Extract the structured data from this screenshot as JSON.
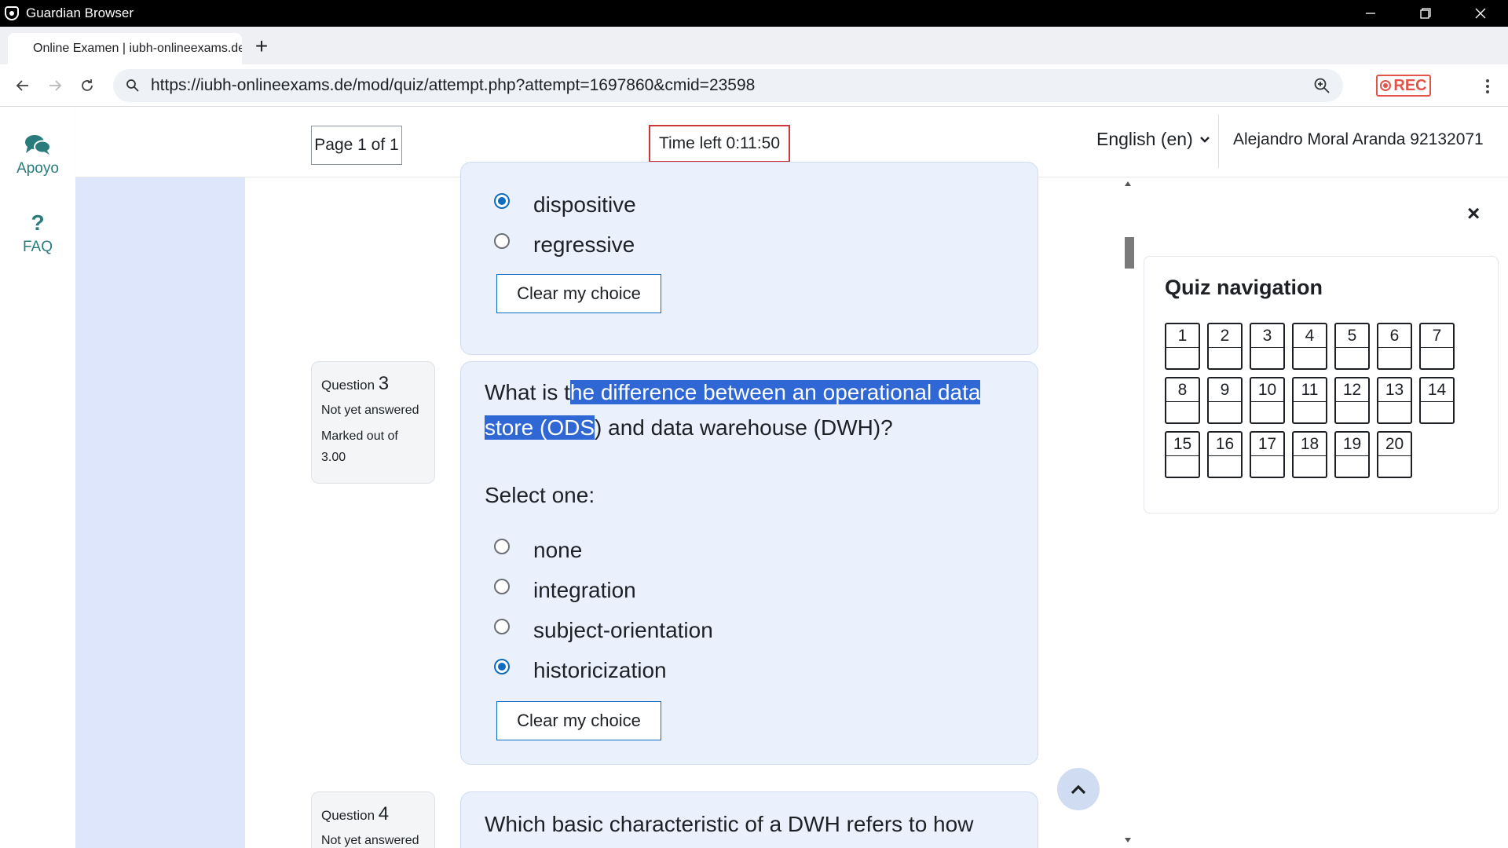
{
  "window": {
    "title": "Guardian Browser"
  },
  "browser": {
    "tab_title": "Online Examen | iubh-onlineexams.de",
    "new_tab": "+",
    "url": "https://iubh-onlineexams.de/mod/quiz/attempt.php?attempt=1697860&cmid=23598",
    "rec_label": "REC"
  },
  "sidebar": {
    "items": [
      {
        "label": "Apoyo",
        "icon": "chat-icon"
      },
      {
        "label": "FAQ",
        "icon": "question-icon"
      }
    ]
  },
  "header": {
    "page": "Page 1 of 1",
    "timer": "Time left 0:11:50",
    "language": "English (en)",
    "user": "Alejandro Moral Aranda 92132071"
  },
  "question2_partial": {
    "options": [
      {
        "label": "dispositive",
        "checked": true
      },
      {
        "label": "regressive",
        "checked": false
      }
    ],
    "clear_label": "Clear my choice"
  },
  "question3": {
    "number_label": "Question",
    "number": "3",
    "status": "Not yet answered",
    "marked": "Marked out of 3.00",
    "text_before": "What is t",
    "text_highlight_1": "he difference between an operational data",
    "text_highlight_2": "store (ODS",
    "text_after": ") and data warehouse (DWH)?",
    "select_label": "Select one:",
    "options": [
      {
        "label": "none",
        "checked": false
      },
      {
        "label": "integration",
        "checked": false
      },
      {
        "label": "subject-orientation",
        "checked": false
      },
      {
        "label": "historicization",
        "checked": true
      }
    ],
    "clear_label": "Clear my choice"
  },
  "question4": {
    "number_label": "Question",
    "number": "4",
    "status": "Not yet answered",
    "text": "Which basic characteristic of a DWH refers to how"
  },
  "quiz_navigation": {
    "title": "Quiz navigation",
    "close": "×",
    "buttons": [
      "1",
      "2",
      "3",
      "4",
      "5",
      "6",
      "7",
      "8",
      "9",
      "10",
      "11",
      "12",
      "13",
      "14",
      "15",
      "16",
      "17",
      "18",
      "19",
      "20"
    ]
  },
  "colors": {
    "accent": "#0f6cbf",
    "timer_border": "#d0353b",
    "highlight": "#2f67d4",
    "sidebar_text": "#2a7c7c",
    "content_bg": "#dde6fb",
    "rec": "#e4534a"
  }
}
